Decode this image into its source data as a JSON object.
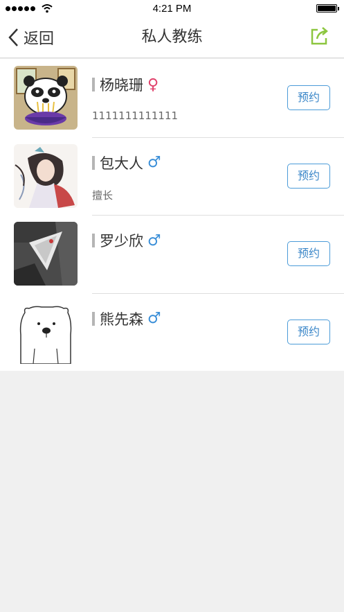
{
  "status_bar": {
    "time": "4:21 PM"
  },
  "nav": {
    "back_label": "返回",
    "title": "私人教练",
    "share_icon": "share-icon",
    "accent_color": "#8cc63f"
  },
  "coaches": [
    {
      "name": "杨晓珊",
      "gender": "female",
      "gender_symbol": "♀",
      "subtitle": "1111111111111",
      "book_label": "预约",
      "avatar": "panda-avatar"
    },
    {
      "name": "包大人",
      "gender": "male",
      "gender_symbol": "♂",
      "subtitle": "擅长",
      "book_label": "预约",
      "avatar": "illustration-avatar"
    },
    {
      "name": "罗少欣",
      "gender": "male",
      "gender_symbol": "♂",
      "subtitle": "",
      "book_label": "预约",
      "avatar": "photo-avatar"
    },
    {
      "name": "熊先森",
      "gender": "male",
      "gender_symbol": "♂",
      "subtitle": "",
      "book_label": "预约",
      "avatar": "bear-avatar"
    }
  ],
  "colors": {
    "female": "#e0406a",
    "male": "#3b8fd8",
    "button": "#4a9bd8"
  }
}
